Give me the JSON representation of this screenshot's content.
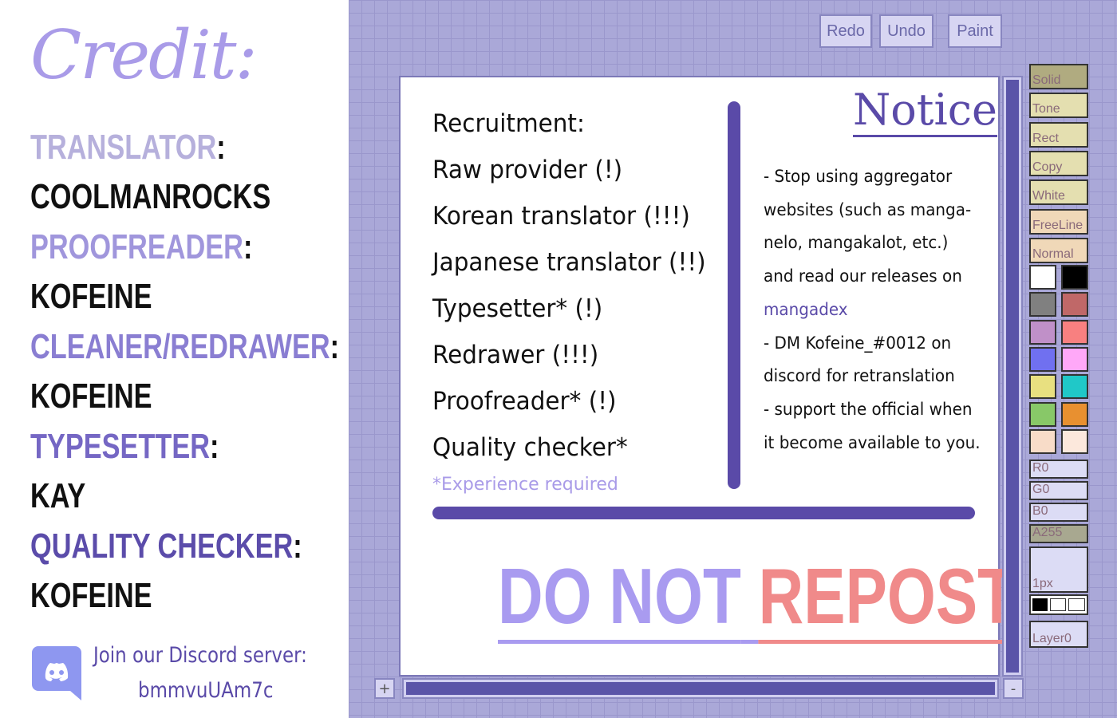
{
  "credits": {
    "title": "Credit:",
    "roles": [
      {
        "role": "TRANSLATOR",
        "name": "COOLMANROCKS",
        "color": "#b6b0dc"
      },
      {
        "role": "PROOFREADER",
        "name": "KOFEINE",
        "color": "#a096dc"
      },
      {
        "role": "CLEANER/REDRAWER",
        "name": "KOFEINE",
        "color": "#8a7ed2"
      },
      {
        "role": "TYPESETTER",
        "name": "KAY",
        "color": "#7567c4"
      },
      {
        "role": "QUALITY CHECKER",
        "name": "KOFEINE",
        "color": "#5b4caa"
      }
    ],
    "colon": ":",
    "discord_line1": "Join our Discord server:",
    "discord_code": "bmmvuUAm7c"
  },
  "toolbar": {
    "redo": "Redo",
    "undo": "Undo",
    "paint": "Paint"
  },
  "recruitment": {
    "title": "Recruitment:",
    "items": [
      "Raw provider (!)",
      "Korean translator (!!!)",
      "Japanese translator (!!)",
      "Typesetter* (!)",
      "Redrawer (!!!)",
      "Proofreader* (!)",
      "Quality checker*"
    ],
    "footnote": "*Experience required"
  },
  "notice": {
    "title": "Notice",
    "lines": [
      "- Stop using aggregator",
      "websites (such as manga-",
      "nelo, mangakalot, etc.)",
      "and read our releases on",
      "mangadex",
      "- DM Kofeine_#0012 on",
      "discord for retranslation",
      "- support the official when",
      "it become available to you."
    ]
  },
  "warning": {
    "part1": "DO NOT",
    "part2": "REPOST",
    "color1": "#a99bf0",
    "color2": "#f08a8a"
  },
  "scroll": {
    "plus": "+",
    "minus": "-"
  },
  "tools": {
    "items": [
      "Solid",
      "Tone",
      "Rect",
      "Copy",
      "White",
      "FreeLine",
      "Normal"
    ],
    "swatches": [
      "#ffffff",
      "#000000",
      "#808080",
      "#c06868",
      "#c090c8",
      "#f88080",
      "#7070f0",
      "#ffa8f8",
      "#e8e080",
      "#20c8c8",
      "#88c868",
      "#e89030",
      "#f8dcc8",
      "#fce8dc"
    ],
    "r": "R0",
    "g": "G0",
    "b": "B0",
    "a": "A255",
    "size": "1px",
    "layer": "Layer0"
  }
}
